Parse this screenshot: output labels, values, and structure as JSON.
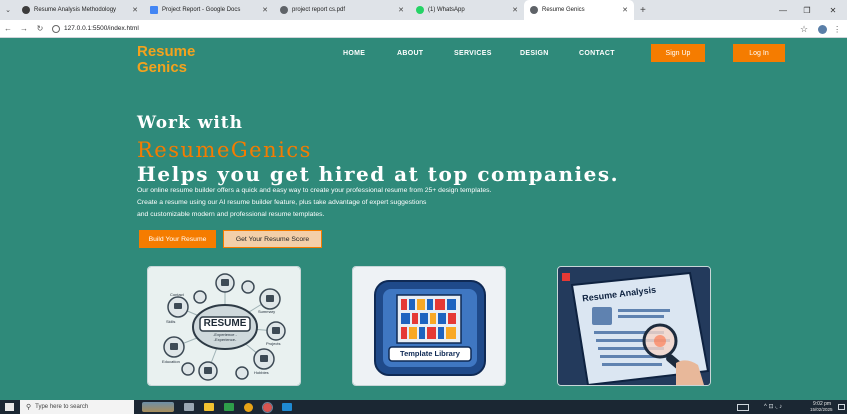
{
  "browser": {
    "tabs": [
      {
        "title": "Resume Analysis Methodology",
        "icon_color": "#3c3c3c",
        "active": false
      },
      {
        "title": "Project Report - Google Docs",
        "icon_color": "#4285f4",
        "active": false
      },
      {
        "title": "project report cs.pdf",
        "icon_color": "#5f6368",
        "active": false
      },
      {
        "title": "(1) WhatsApp",
        "icon_color": "#25d366",
        "active": false
      },
      {
        "title": "Resume Genics",
        "icon_color": "#5f6368",
        "active": true
      }
    ],
    "new_tab": "+",
    "address": "127.0.0.1:5500/index.html",
    "window_controls": [
      "—",
      "❐",
      "✕"
    ]
  },
  "site": {
    "logo": "Resume Genics",
    "nav": [
      "HOME",
      "ABOUT",
      "SERVICES",
      "DESIGN",
      "CONTACT"
    ],
    "signup_label": "Sign Up",
    "login_label": "Log In"
  },
  "hero": {
    "line1": "Work with",
    "line2": "ResumeGenics",
    "line3": "Helps you get hired at top companies.",
    "desc": [
      "Our online resume builder offers a quick and easy way to create your professional resume from 25+ design templates.",
      "Create a resume using our AI resume builder feature, plus take advantage of expert suggestions",
      "and customizable modern and professional resume templates."
    ],
    "cta_primary": "Build Your Resume",
    "cta_secondary": "Get Your Resume Score"
  },
  "cards": {
    "resume": {
      "title": "RESUME",
      "subtitle": "-Experience -",
      "subtitle2": "-Experience-",
      "nodes": [
        "Skills",
        "Contact",
        "Education",
        "Summary",
        "Projects",
        "Hobbies"
      ]
    },
    "templates": {
      "label": "Template Library"
    },
    "analysis": {
      "label": "Resume Analysis"
    }
  },
  "taskbar": {
    "search_placeholder": "Type here to search",
    "time": "9:02 pm",
    "date": "15/02/2025"
  },
  "colors": {
    "page_bg": "#2f8a7a",
    "accent_orange": "#f57c00",
    "logo_orange": "#f4a21d"
  }
}
